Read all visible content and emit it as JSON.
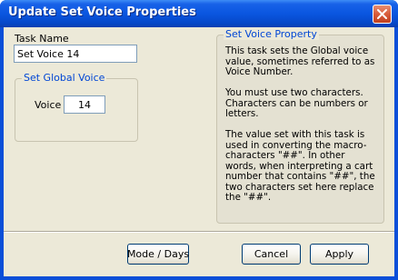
{
  "window": {
    "title": "Update Set Voice Properties"
  },
  "task": {
    "label": "Task Name",
    "value": "Set Voice 14"
  },
  "global_voice_group": {
    "title": "Set Global Voice",
    "voice_label": "Voice",
    "voice_value": "14"
  },
  "info": {
    "title": "Set Voice Property",
    "paragraphs": [
      "This task sets the Global voice value, sometimes referred to as Voice Number.",
      "You must use two characters. Characters can be numbers or letters.",
      "The value set with this task is used in converting the macro-characters \"##\". In other words, when interpreting a cart number that contains \"##\", the two characters set here replace the \"##\"."
    ]
  },
  "buttons": {
    "mode_days": "Mode / Days",
    "cancel": "Cancel",
    "apply": "Apply"
  },
  "colors": {
    "titlebar": "#0a56e0",
    "close_button": "#d85c3a",
    "group_title": "#0046d5",
    "dialog_background": "#ece9d8"
  }
}
